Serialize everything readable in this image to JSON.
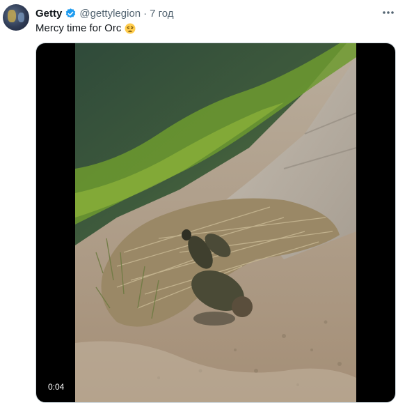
{
  "tweet": {
    "display_name": "Getty",
    "handle": "@gettylegion",
    "separator": "·",
    "timestamp": "7 год",
    "text": "Mercy time for Orc",
    "emoji": "weary-face-emoji",
    "verified_badge": "verified-badge-icon",
    "more_menu_icon": "more-horizontal-icon"
  },
  "media": {
    "type": "video",
    "duration": "0:04"
  },
  "colors": {
    "verified_blue": "#1d9bf0",
    "secondary_text": "#536471",
    "primary_text": "#0f1419"
  }
}
